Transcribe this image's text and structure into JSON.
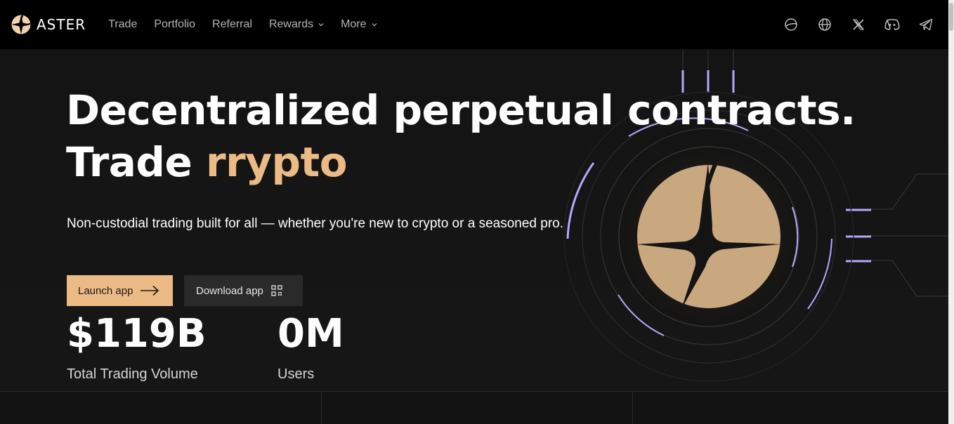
{
  "header": {
    "brand": "ASTER",
    "nav": [
      {
        "label": "Trade",
        "dropdown": false
      },
      {
        "label": "Portfolio",
        "dropdown": false
      },
      {
        "label": "Referral",
        "dropdown": false
      },
      {
        "label": "Rewards",
        "dropdown": true
      },
      {
        "label": "More",
        "dropdown": true
      }
    ],
    "socials": [
      "planet-icon",
      "globe-icon",
      "x-icon",
      "discord-icon",
      "telegram-icon"
    ]
  },
  "hero": {
    "headline_line1": "Decentralized perpetual contracts.",
    "headline_line2_prefix": "Trade ",
    "headline_line2_accent": "rrypto",
    "subtitle": "Non-custodial trading built for all — whether you're new to crypto or a seasoned pro.",
    "launch_label": "Launch app",
    "download_label": "Download app"
  },
  "stats": [
    {
      "value": "$119B",
      "label": "Total Trading Volume"
    },
    {
      "value": "0M",
      "label": "Users"
    }
  ],
  "colors": {
    "accent": "#ecba84",
    "background": "#121212",
    "glow": "#9d8ff0"
  }
}
